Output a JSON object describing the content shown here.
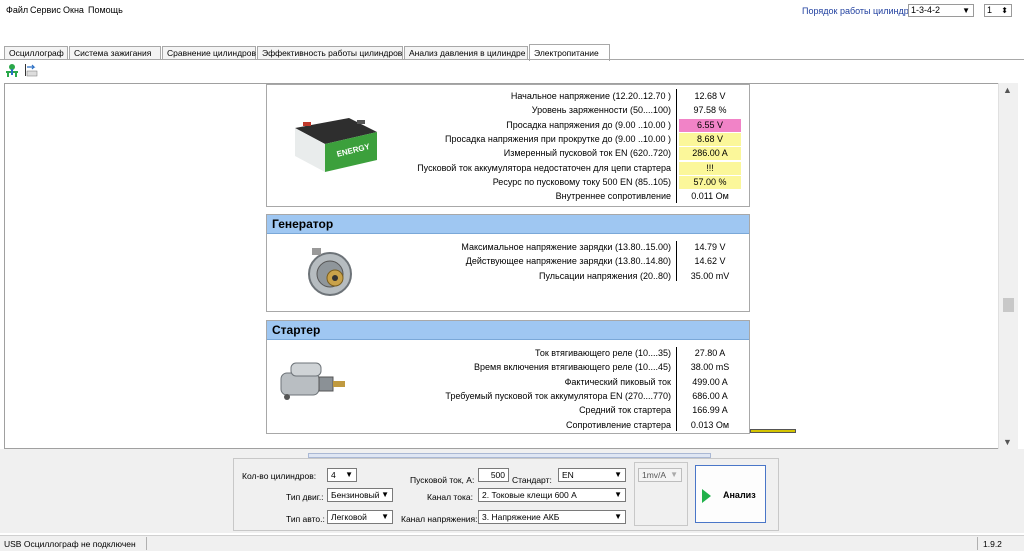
{
  "menu": [
    "Файл",
    "Сервис",
    "Окна",
    "Помощь"
  ],
  "cylinder_order": {
    "label": "Порядок работы цилиндров",
    "value": "1-3-4-2",
    "cylinder_num": "1"
  },
  "tabs": [
    "Осциллограф",
    "Система зажигания",
    "Сравнение цилиндров",
    "Эффективность работы цилиндров",
    "Анализ давления в цилиндре",
    "Электропитание"
  ],
  "active_tab": "Электропитание",
  "battery": {
    "image_label": "ENERGY",
    "rows": [
      {
        "label": "Начальное напряжение (12.20..12.70 )",
        "value": "12.68 V",
        "highlight": "none"
      },
      {
        "label": "Уровень заряженности (50....100)",
        "value": "97.58 %",
        "highlight": "none"
      },
      {
        "label": "Просадка напряжения до (9.00 ..10.00 )",
        "value": "6.55 V",
        "highlight": "#f183c7"
      },
      {
        "label": "Просадка напряжения при прокрутке до (9.00 ..10.00 )",
        "value": "8.68 V",
        "highlight": "#fbf79a"
      },
      {
        "label": "Измеренный пусковой ток  EN (620..720)",
        "value": "286.00 A",
        "highlight": "#fbf79a"
      },
      {
        "label": "Пусковой ток аккумулятора недостаточен для цепи стартера",
        "value": "!!!",
        "highlight": "#fbf79a"
      },
      {
        "label": "Ресурс по пусковому току  500 EN (85..105)",
        "value": "57.00 %",
        "highlight": "#fbf79a"
      },
      {
        "label": "Внутреннее сопротивление",
        "value": "0.011 Ом",
        "highlight": "none"
      }
    ]
  },
  "generator": {
    "title": "Генератор",
    "rows": [
      {
        "label": "Максимальное напряжение зарядки  (13.80..15.00)",
        "value": "14.79 V"
      },
      {
        "label": "Действующее напряжение зарядки (13.80..14.80)",
        "value": "14.62 V"
      },
      {
        "label": "Пульсации напряжения (20..80)",
        "value": "35.00 mV"
      }
    ]
  },
  "starter": {
    "title": "Стартер",
    "rows": [
      {
        "label": "Ток втягивающего реле (10....35)",
        "value": "27.80 A"
      },
      {
        "label": "Время включения втягивающего реле (10....45)",
        "value": "38.00 mS"
      },
      {
        "label": "Фактический пиковый ток",
        "value": "499.00 A"
      },
      {
        "label": "Требуемый пусковой ток аккумулятора  EN (270....770)",
        "value": "686.00 A"
      },
      {
        "label": "Средний ток стартера",
        "value": "166.99 A"
      },
      {
        "label": "Сопротивление стартера",
        "value": "0.013 Ом"
      }
    ]
  },
  "controls": {
    "cyl_count_label": "Кол-во цилиндров:",
    "cyl_count": "4",
    "engine_type_label": "Тип двиг.:",
    "engine_type": "Бензиновый",
    "car_type_label": "Тип авто.:",
    "car_type": "Легковой",
    "start_current_label": "Пусковой ток, А:",
    "start_current": "500",
    "standard_label": "Стандарт:",
    "standard": "EN",
    "current_channel_label": "Канал тока:",
    "current_channel": "2. Токовые клещи 600 А",
    "voltage_channel_label": "Канал напряжения:",
    "voltage_channel": "3. Напряжение АКБ",
    "scale": "1mv/A",
    "analyze": "Анализ"
  },
  "status": {
    "message": "USB Осциллограф не подключен",
    "version": "1.9.2"
  },
  "colors": {
    "header_blue": "#9fc7f2",
    "warn_yellow": "#fbf79a",
    "alert_pink": "#f183c7",
    "accent_green": "#21b14a"
  }
}
